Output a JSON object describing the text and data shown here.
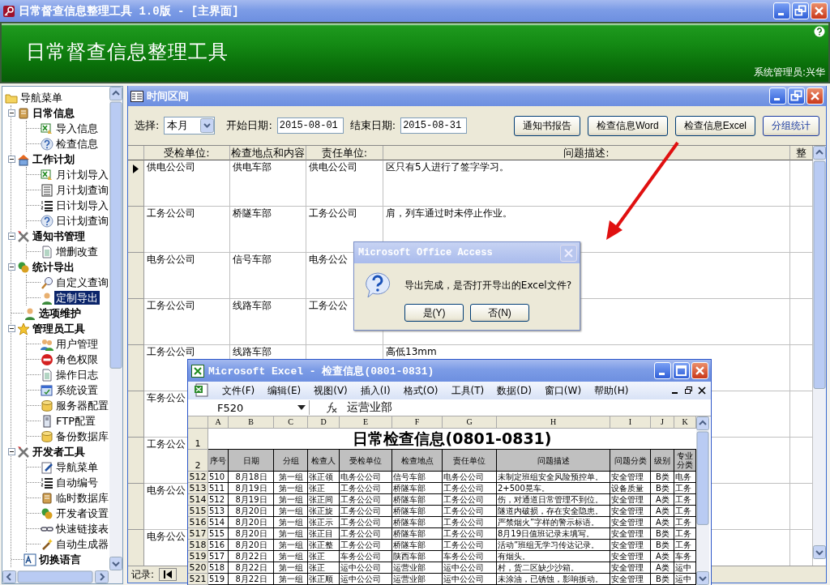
{
  "window": {
    "title": "日常督查信息整理工具 1.0版 - [主界面]"
  },
  "banner": {
    "title": "日常督查信息整理工具",
    "user": "系统管理员:兴华"
  },
  "sidebar": {
    "root": {
      "label": "导航菜单",
      "kind": "folder",
      "selected": false
    },
    "items": [
      {
        "label": "日常信息",
        "kind": "book",
        "selected": false,
        "expanded": true,
        "children": [
          {
            "label": "导入信息",
            "kind": "spreadsheet",
            "selected": false
          },
          {
            "label": "检查信息",
            "kind": "question",
            "selected": false
          }
        ]
      },
      {
        "label": "工作计划",
        "kind": "house",
        "selected": false,
        "expanded": true,
        "children": [
          {
            "label": "月计划导入",
            "kind": "spreadsheet",
            "selected": false
          },
          {
            "label": "月计划查询",
            "kind": "list",
            "selected": false
          },
          {
            "label": "日计划导入",
            "kind": "numbered",
            "selected": false
          },
          {
            "label": "日计划查询",
            "kind": "question",
            "selected": false
          }
        ]
      },
      {
        "label": "通知书管理",
        "kind": "tools",
        "selected": false,
        "expanded": true,
        "children": [
          {
            "label": "增删改查",
            "kind": "document",
            "selected": false
          }
        ]
      },
      {
        "label": "统计导出",
        "kind": "coins",
        "selected": false,
        "expanded": true,
        "children": [
          {
            "label": "自定义查询",
            "kind": "magnifier",
            "selected": false
          },
          {
            "label": "定制导出",
            "kind": "person",
            "selected": true
          }
        ]
      },
      {
        "label": "选项维护",
        "kind": "person",
        "selected": false
      },
      {
        "label": "管理员工具",
        "kind": "star",
        "selected": false,
        "expanded": true,
        "children": [
          {
            "label": "用户管理",
            "kind": "people",
            "selected": false
          },
          {
            "label": "角色权限",
            "kind": "stop",
            "selected": false
          },
          {
            "label": "操作日志",
            "kind": "document",
            "selected": false
          },
          {
            "label": "系统设置",
            "kind": "window",
            "selected": false
          },
          {
            "label": "服务器配置",
            "kind": "database",
            "selected": false
          },
          {
            "label": "FTP配置",
            "kind": "server",
            "selected": false
          },
          {
            "label": "备份数据库",
            "kind": "database",
            "selected": false
          }
        ]
      },
      {
        "label": "开发者工具",
        "kind": "tools",
        "selected": false,
        "expanded": true,
        "children": [
          {
            "label": "导航菜单",
            "kind": "edit",
            "selected": false
          },
          {
            "label": "自动编号",
            "kind": "numbered",
            "selected": false
          },
          {
            "label": "临时数据库",
            "kind": "book",
            "selected": false
          },
          {
            "label": "开发者设置",
            "kind": "coins",
            "selected": false
          },
          {
            "label": "快速链接表",
            "kind": "link",
            "selected": false
          },
          {
            "label": "自动生成器",
            "kind": "wand",
            "selected": false
          }
        ]
      },
      {
        "label": "切换语言",
        "kind": "font",
        "selected": false
      }
    ]
  },
  "subwindow": {
    "title": "时间区间",
    "filters": {
      "select_label": "选择:",
      "select_value": "本月",
      "start_label": "开始日期:",
      "start_value": "2015-08-01",
      "end_label": "结束日期:",
      "end_value": "2015-08-31"
    },
    "buttons": [
      {
        "label": "通知书报告",
        "default": false
      },
      {
        "label": "检查信息Word",
        "default": false
      },
      {
        "label": "检查信息Excel",
        "default": false
      },
      {
        "label": "分组统计",
        "default": true
      }
    ],
    "table": {
      "columns": [
        "受检单位:",
        "检查地点和内容",
        "责任单位:",
        "问题描述:",
        "整"
      ],
      "rows": [
        {
          "selected": true,
          "inspected_unit": "供电公公司",
          "location": "供电车部",
          "responsible_unit": "供电公公司",
          "description": "区只有5人进行了签字学习。"
        },
        {
          "selected": false,
          "inspected_unit": "工务公公司",
          "location": "桥隧车部",
          "responsible_unit": "工务公公司",
          "description": "肩，列车通过时未停止作业。"
        },
        {
          "selected": false,
          "inspected_unit": "电务公公司",
          "location": "信号车部",
          "responsible_unit": "电务公公"
        },
        {
          "selected": false,
          "inspected_unit": "工务公公司",
          "location": "线路车部",
          "responsible_unit": "工务公公"
        },
        {
          "selected": false,
          "inspected_unit": "工务公公司",
          "location": "线路车部",
          "description": "高低13mm"
        },
        {
          "selected": false,
          "inspected_unit": "车务公公"
        },
        {
          "selected": false,
          "inspected_unit": "工务公公"
        },
        {
          "selected": false,
          "inspected_unit": "电务公公"
        },
        {
          "selected": false,
          "inspected_unit": "电务公公"
        }
      ]
    },
    "record_nav": {
      "label": "记录:"
    }
  },
  "dialog": {
    "title": "Microsoft Office Access",
    "message": "导出完成，是否打开导出的Excel文件?",
    "buttons": [
      "是(Y)",
      "否(N)"
    ]
  },
  "excel": {
    "title": "Microsoft Excel - 检查信息(0801-0831)",
    "menu": [
      "文件(F)",
      "编辑(E)",
      "视图(V)",
      "插入(I)",
      "格式(O)",
      "工具(T)",
      "数据(D)",
      "窗口(W)",
      "帮助(H)"
    ],
    "name_box": "F520",
    "formula": "运营业部",
    "columns": [
      "A",
      "B",
      "C",
      "D",
      "E",
      "F",
      "G",
      "H",
      "I",
      "J",
      "K"
    ],
    "title_row": "1",
    "sheet_title": "日常检查信息(0801-0831)",
    "header_row": "2",
    "headers": [
      "序号",
      "日期",
      "分组",
      "检查人",
      "受检单位",
      "检查地点",
      "责任单位",
      "问题描述",
      "问题分类",
      "级别",
      "专业分类"
    ],
    "rows": [
      {
        "row_number": "512",
        "cells": [
          "510",
          "8月18日",
          "第一组",
          "张正领",
          "电务公公司",
          "信号车部",
          "电务公公司",
          "未制定班组安全风险预控单。",
          "安全管理",
          "B类",
          "电务"
        ]
      },
      {
        "row_number": "513",
        "cells": [
          "511",
          "8月19日",
          "第一组",
          "张正",
          "工务公公司",
          "桥隧车部",
          "工务公公司",
          "2+500晃车。",
          "设备质量",
          "B类",
          "工务"
        ]
      },
      {
        "row_number": "514",
        "cells": [
          "512",
          "8月19日",
          "第一组",
          "张正间",
          "工务公公司",
          "桥隧车部",
          "工务公公司",
          "伤，对通道日常管理不到位。",
          "安全管理",
          "A类",
          "工务"
        ]
      },
      {
        "row_number": "515",
        "cells": [
          "513",
          "8月20日",
          "第一组",
          "张正旋",
          "工务公公司",
          "桥隧车部",
          "工务公公司",
          "隧道内破损，存在安全隐患。",
          "安全管理",
          "A类",
          "工务"
        ]
      },
      {
        "row_number": "516",
        "cells": [
          "514",
          "8月20日",
          "第一组",
          "张正示",
          "工务公公司",
          "桥隧车部",
          "工务公公司",
          "严禁烟火”字样的警示标语。",
          "安全管理",
          "A类",
          "工务"
        ]
      },
      {
        "row_number": "517",
        "cells": [
          "515",
          "8月20日",
          "第一组",
          "张正目",
          "工务公公司",
          "桥隧车部",
          "工务公公司",
          "8月19日值班记录未填写。",
          "安全管理",
          "B类",
          "工务"
        ]
      },
      {
        "row_number": "518",
        "cells": [
          "516",
          "8月20日",
          "第一组",
          "张正整",
          "工务公公司",
          "桥隧车部",
          "工务公公司",
          "活动”班组无学习传达记录。",
          "安全管理",
          "B类",
          "工务"
        ]
      },
      {
        "row_number": "519",
        "cells": [
          "517",
          "8月22日",
          "第一组",
          "张正",
          "车务公公司",
          "陕西车部",
          "车务公公司",
          "有烟头。",
          "安全管理",
          "A类",
          "车务"
        ]
      },
      {
        "row_number": "520",
        "cells": [
          "518",
          "8月22日",
          "第一组",
          "张正",
          "运中公公司",
          "运营业部",
          "运中公公司",
          "村，货二区缺少沙箱。",
          "安全管理",
          "A类",
          "运中"
        ]
      },
      {
        "row_number": "521",
        "cells": [
          "519",
          "8月22日",
          "第一组",
          "张正顺",
          "运中公公司",
          "运营业部",
          "运中公公司",
          "未涂油，已锈蚀，影响扳动。",
          "安全管理",
          "B类",
          "运中"
        ]
      }
    ]
  }
}
